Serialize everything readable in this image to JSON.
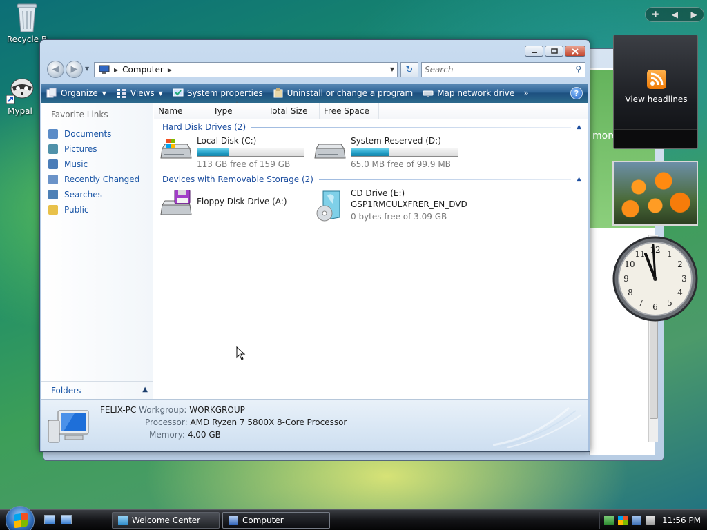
{
  "desktop": {
    "icons": [
      {
        "label": "Recycle B",
        "icon": "recycle-bin-icon"
      },
      {
        "label": "Mypal",
        "icon": "mypal-raccoon-icon"
      }
    ]
  },
  "background_window": {
    "text": "more"
  },
  "window": {
    "address": {
      "crumb": "Computer"
    },
    "search": {
      "placeholder": "Search"
    },
    "toolbar": {
      "items": [
        {
          "label": "Organize",
          "icon": "organize-icon",
          "dropdown": true
        },
        {
          "label": "Views",
          "icon": "views-icon",
          "dropdown": true
        },
        {
          "label": "System properties",
          "icon": "system-properties-icon"
        },
        {
          "label": "Uninstall or change a program",
          "icon": "uninstall-icon"
        },
        {
          "label": "Map network drive",
          "icon": "map-drive-icon"
        }
      ],
      "more": "»",
      "help": "?"
    },
    "nav_pane": {
      "title": "Favorite Links",
      "links": [
        {
          "label": "Documents",
          "color": "#5b8cc7"
        },
        {
          "label": "Pictures",
          "color": "#4f91a9"
        },
        {
          "label": "Music",
          "color": "#4a7db8"
        },
        {
          "label": "Recently Changed",
          "color": "#6a93c8"
        },
        {
          "label": "Searches",
          "color": "#4d80b6"
        },
        {
          "label": "Public",
          "color": "#e8c14a"
        }
      ],
      "folders_label": "Folders"
    },
    "columns": [
      "Name",
      "Type",
      "Total Size",
      "Free Space"
    ],
    "groups": [
      {
        "title": "Hard Disk Drives (2)",
        "drives": [
          {
            "name": "Local Disk (C:)",
            "free_text": "113 GB free of 159 GB",
            "used_fraction": 0.29,
            "icon": "hard-drive-windows-icon"
          },
          {
            "name": "System Reserved (D:)",
            "free_text": "65.0 MB free of 99.9 MB",
            "used_fraction": 0.35,
            "icon": "hard-drive-icon"
          }
        ]
      },
      {
        "title": "Devices with Removable Storage (2)",
        "drives": [
          {
            "name": "Floppy Disk Drive (A:)",
            "icon": "floppy-drive-icon"
          },
          {
            "name": "CD Drive (E:)",
            "label": "GSP1RMCULXFRER_EN_DVD",
            "free_text": "0 bytes free of 3.09 GB",
            "icon": "cd-drive-icon"
          }
        ]
      }
    ],
    "details": {
      "computer_name": "FELIX-PC",
      "workgroup_label": "Workgroup:",
      "workgroup": "WORKGROUP",
      "processor_label": "Processor:",
      "processor": "AMD Ryzen 7 5800X 8-Core Processor",
      "memory_label": "Memory:",
      "memory": "4.00 GB"
    }
  },
  "sidebar": {
    "feed_label": "View headlines"
  },
  "taskbar": {
    "buttons": [
      {
        "label": "Welcome Center"
      },
      {
        "label": "Computer"
      }
    ],
    "clock": "11:56 PM"
  }
}
